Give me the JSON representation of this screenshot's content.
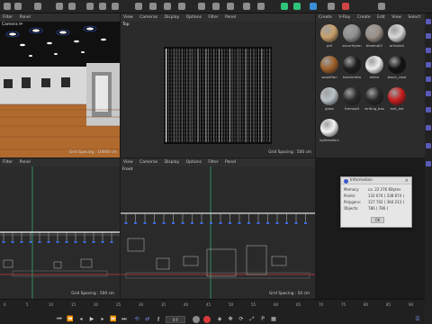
{
  "toolbar": {
    "icons": [
      "undo-icon",
      "redo-icon",
      "select-icon",
      "move-icon",
      "scale-icon",
      "rotate-icon",
      "model-icon",
      "axis-icon",
      "tag-icon",
      "render-view-icon",
      "render-icon",
      "render-settings-icon",
      "cube-icon",
      "pen-icon",
      "subdivision-icon",
      "array-icon",
      "deformer-icon",
      "field-icon",
      "floor-icon",
      "camera-icon",
      "light-icon",
      "tag-icon-2",
      "misc-icon"
    ]
  },
  "viewports": {
    "perspective": {
      "menu": [
        "Filter",
        "Panel"
      ],
      "camera_label": "Camera ⟳·",
      "grid": "Grid Spacing : 10000 cm"
    },
    "top": {
      "menu": [
        "View",
        "Cameras",
        "Display",
        "Options",
        "Filter",
        "Panel"
      ],
      "title": "Top",
      "grid": "Grid Spacing : 500 cm"
    },
    "left": {
      "menu": [
        "Filter",
        "Panel"
      ],
      "grid": "Grid Spacing : 500 cm"
    },
    "front": {
      "menu": [
        "View",
        "Cameras",
        "Display",
        "Options",
        "Filter",
        "Panel"
      ],
      "title": "Front",
      "grid": "Grid Spacing : 50 cm"
    }
  },
  "materials": {
    "menu": [
      "Create",
      "V-Ray",
      "Create",
      "Edit",
      "View",
      "Select"
    ],
    "items": [
      {
        "label": "pof",
        "color": "#c9a06a"
      },
      {
        "label": "securityam",
        "color": "#8f8f8f"
      },
      {
        "label": "bloempt2",
        "color": "#9a8f86"
      },
      {
        "label": "arlicolari",
        "color": "#d8d8d8"
      },
      {
        "label": "woodflori",
        "color": "#a0612a"
      },
      {
        "label": "blackmeta",
        "color": "#1e1e1e"
      },
      {
        "label": "white",
        "color": "#eeeeee"
      },
      {
        "label": "black_case",
        "color": "#111111"
      },
      {
        "label": "glass",
        "color": "#b8c2c8"
      },
      {
        "label": "frameplt",
        "color": "#2a2a2a"
      },
      {
        "label": "writing_box",
        "color": "#262626"
      },
      {
        "label": "exit_led",
        "color": "#c71d1d"
      },
      {
        "label": "lightmaterc",
        "color": "#f4f4f4"
      }
    ]
  },
  "info": {
    "title": "Information",
    "rows": [
      {
        "label": "Memory:",
        "value": "ca. 22 276 KBytes"
      },
      {
        "label": "Points:",
        "value": "132 674 ( 338 874 )"
      },
      {
        "label": "Polygons:",
        "value": "127 702 ( 364 213 )"
      },
      {
        "label": "Objects:",
        "value": "786 ( 786 )"
      }
    ],
    "ok": "OK"
  },
  "timeline": {
    "ticks": [
      "0",
      "5",
      "10",
      "15",
      "20",
      "25",
      "30",
      "35",
      "40",
      "45",
      "50",
      "55",
      "60",
      "65",
      "70",
      "75",
      "80",
      "85",
      "90"
    ],
    "frame": "0 F"
  },
  "colors": {
    "accent_blue": "#4a6bd8",
    "record_red": "#d83a3a",
    "axis_green": "#2fa36b",
    "axis_red": "#c43a3a"
  }
}
